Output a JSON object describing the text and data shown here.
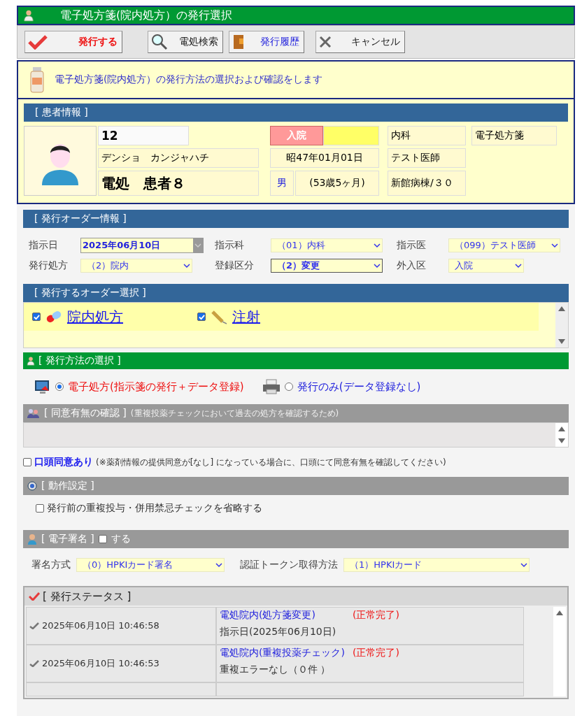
{
  "window": {
    "title": "電子処方箋(院内処方）の発行選択"
  },
  "toolbar": [
    {
      "kind": "issue",
      "label": "発行する"
    },
    {
      "kind": "search",
      "label": "電処検索"
    },
    {
      "kind": "history",
      "label": "発行履歴"
    },
    {
      "kind": "cancel",
      "label": "キャンセル"
    }
  ],
  "banner": "電子処方箋(院内処方）の発行方法の選択および確認をします",
  "patient": {
    "title": "[ 患者情報 ]",
    "id": "12",
    "kana": "デンショ　カンジャハチ",
    "name": "電処　患者８",
    "status": "入院",
    "birth": "昭47年01月01日",
    "sex": "男",
    "age": "(53歳5ヶ月)",
    "department": "内科",
    "doctor": "テスト医師",
    "ward": "新館病棟/３０",
    "type": "電子処方箋"
  },
  "order_info": {
    "title": "[ 発行オーダー情報 ]",
    "fields": [
      {
        "label": "指示日",
        "value": "2025年06月10日",
        "kind": "date"
      },
      {
        "label": "指示科",
        "value": "（01）内科",
        "kind": "select"
      },
      {
        "label": "指示医",
        "value": "（099）テスト医師",
        "kind": "select"
      },
      {
        "label": "発行処方",
        "value": "（2）院内",
        "kind": "select"
      },
      {
        "label": "登録区分",
        "value": "（2）変更",
        "kind": "focused"
      },
      {
        "label": "外入区",
        "value": "入院",
        "kind": "select"
      }
    ]
  },
  "order_select": {
    "title": "[ 発行するオーダー選択 ]",
    "items": [
      {
        "kind": "capsule",
        "label": "院内処方",
        "checked": true
      },
      {
        "kind": "syringe",
        "label": "注射",
        "checked": true
      }
    ]
  },
  "method": {
    "title": "[ 発行方法の選択 ]",
    "options": [
      {
        "kind": "monitor",
        "label": "電子処方(指示箋の発行＋データ登録)",
        "selected": true
      },
      {
        "kind": "printer",
        "label": "発行のみ(データ登録なし)",
        "selected": false
      }
    ]
  },
  "consent": {
    "title": "[ 同意有無の確認 ]",
    "note": "(重複投薬チェックにおいて過去の処方を確認するため)",
    "checkbox": {
      "label": "口頭同意あり",
      "checked": false
    },
    "hint": "(※薬剤情報の提供同意が[なし] になっている場合に、口頭にて同意有無を確認してください)"
  },
  "action": {
    "title": "[ 動作設定 ]",
    "checkbox": {
      "label": "発行前の重複投与・併用禁忌チェックを省略する",
      "checked": false
    }
  },
  "signature": {
    "title": "[ 電子署名 ]",
    "checkbox": {
      "label": "する",
      "checked": false
    },
    "fields": [
      {
        "label": "署名方式",
        "value": "（0）HPKIカード署名"
      },
      {
        "label": "認証トークン取得方法",
        "value": "（1）HPKIカード"
      }
    ]
  },
  "status": {
    "title": "[ 発行ステータス ]",
    "rows": [
      {
        "time": "2025年06月10日 10:46:58",
        "action": "電処院内(処方箋変更)",
        "result": "(正常完了)",
        "detail": "指示日(2025年06月10日)"
      },
      {
        "time": "2025年06月10日 10:46:53",
        "action": "電処院内(重複投薬チェック)",
        "result": "(正常完了)",
        "detail": "重複エラーなし（０件 ）"
      }
    ]
  }
}
